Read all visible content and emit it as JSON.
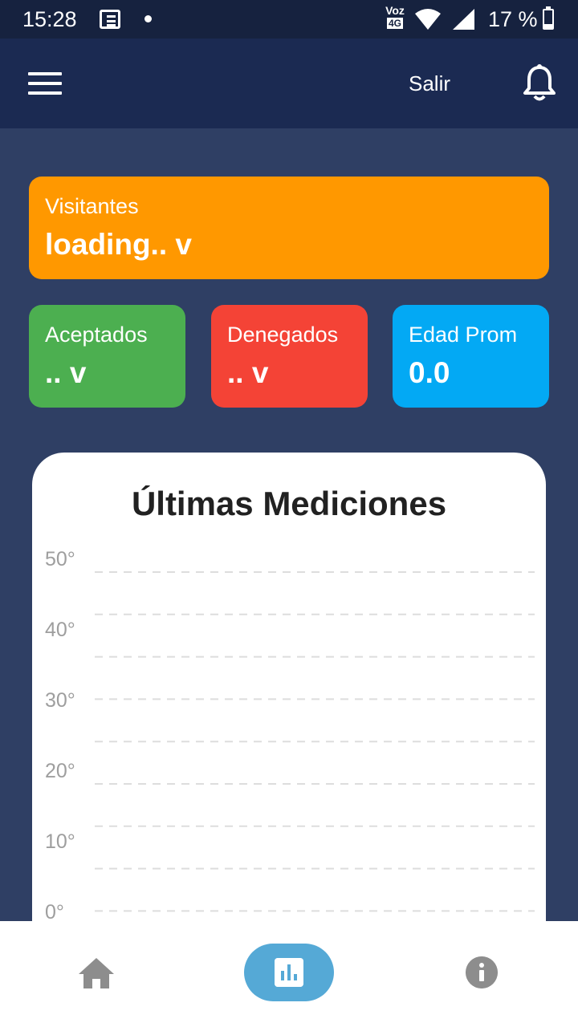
{
  "status_bar": {
    "time": "15:28",
    "voz": "Voz",
    "network": "4G",
    "battery": "17 %"
  },
  "app_bar": {
    "logout_label": "Salir",
    "icons": [
      "menu-icon",
      "bell-icon"
    ]
  },
  "cards": {
    "visitantes": {
      "label": "Visitantes",
      "value": "loading.. v",
      "color": "#ff9800"
    },
    "aceptados": {
      "label": "Aceptados",
      "value": ".. v",
      "color": "#4caf50"
    },
    "denegados": {
      "label": "Denegados",
      "value": ".. v",
      "color": "#f44336"
    },
    "edad_prom": {
      "label": "Edad Prom",
      "value": "0.0",
      "color": "#03a9f4"
    }
  },
  "chart_data": {
    "type": "line",
    "title": "Últimas Mediciones",
    "yticks": [
      "50°",
      "40°",
      "30°",
      "20°",
      "10°",
      "0°"
    ],
    "ylim": [
      0,
      50
    ],
    "grid": true,
    "series": []
  },
  "bottom_nav": {
    "items": [
      "home-icon",
      "bar-chart-icon",
      "info-icon"
    ],
    "active": "bar-chart-icon",
    "active_color": "#55a9d6"
  }
}
